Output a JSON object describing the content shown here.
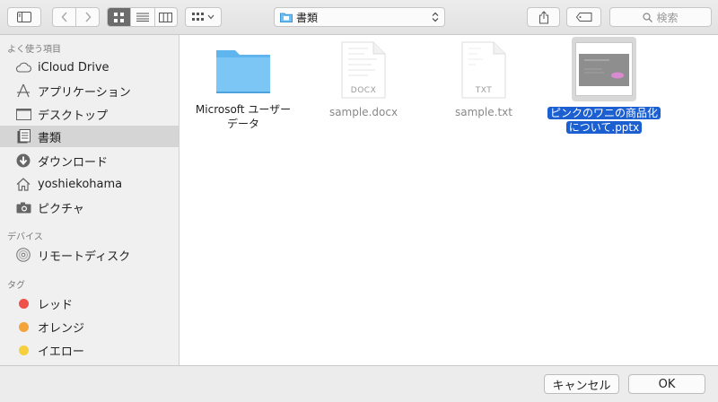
{
  "toolbar": {
    "location": "書類",
    "search_placeholder": "検索"
  },
  "sidebar": {
    "favorites_header": "よく使う項目",
    "favorites": [
      {
        "label": "iCloud Drive",
        "icon": "cloud-icon"
      },
      {
        "label": "アプリケーション",
        "icon": "applications-icon"
      },
      {
        "label": "デスクトップ",
        "icon": "desktop-icon"
      },
      {
        "label": "書類",
        "icon": "documents-icon",
        "selected": true
      },
      {
        "label": "ダウンロード",
        "icon": "download-icon"
      },
      {
        "label": "yoshiekohama",
        "icon": "home-icon"
      },
      {
        "label": "ピクチャ",
        "icon": "camera-icon"
      }
    ],
    "devices_header": "デバイス",
    "devices": [
      {
        "label": "リモートディスク",
        "icon": "disc-icon"
      }
    ],
    "tags_header": "タグ",
    "tags": [
      {
        "label": "レッド",
        "color": "#f0504a"
      },
      {
        "label": "オレンジ",
        "color": "#f4a23a"
      },
      {
        "label": "イエロー",
        "color": "#f6cf3c"
      }
    ]
  },
  "files": [
    {
      "name_line1": "Microsoft ユーザー",
      "name_line2": "データ",
      "type": "folder"
    },
    {
      "name_line1": "sample.docx",
      "type": "docx",
      "badge": "DOCX"
    },
    {
      "name_line1": "sample.txt",
      "type": "txt",
      "badge": "TXT"
    },
    {
      "name_line1": "ピンクのワニの商品化",
      "name_line2": "について.pptx",
      "type": "pptx",
      "selected": true
    }
  ],
  "footer": {
    "cancel": "キャンセル",
    "ok": "OK"
  }
}
